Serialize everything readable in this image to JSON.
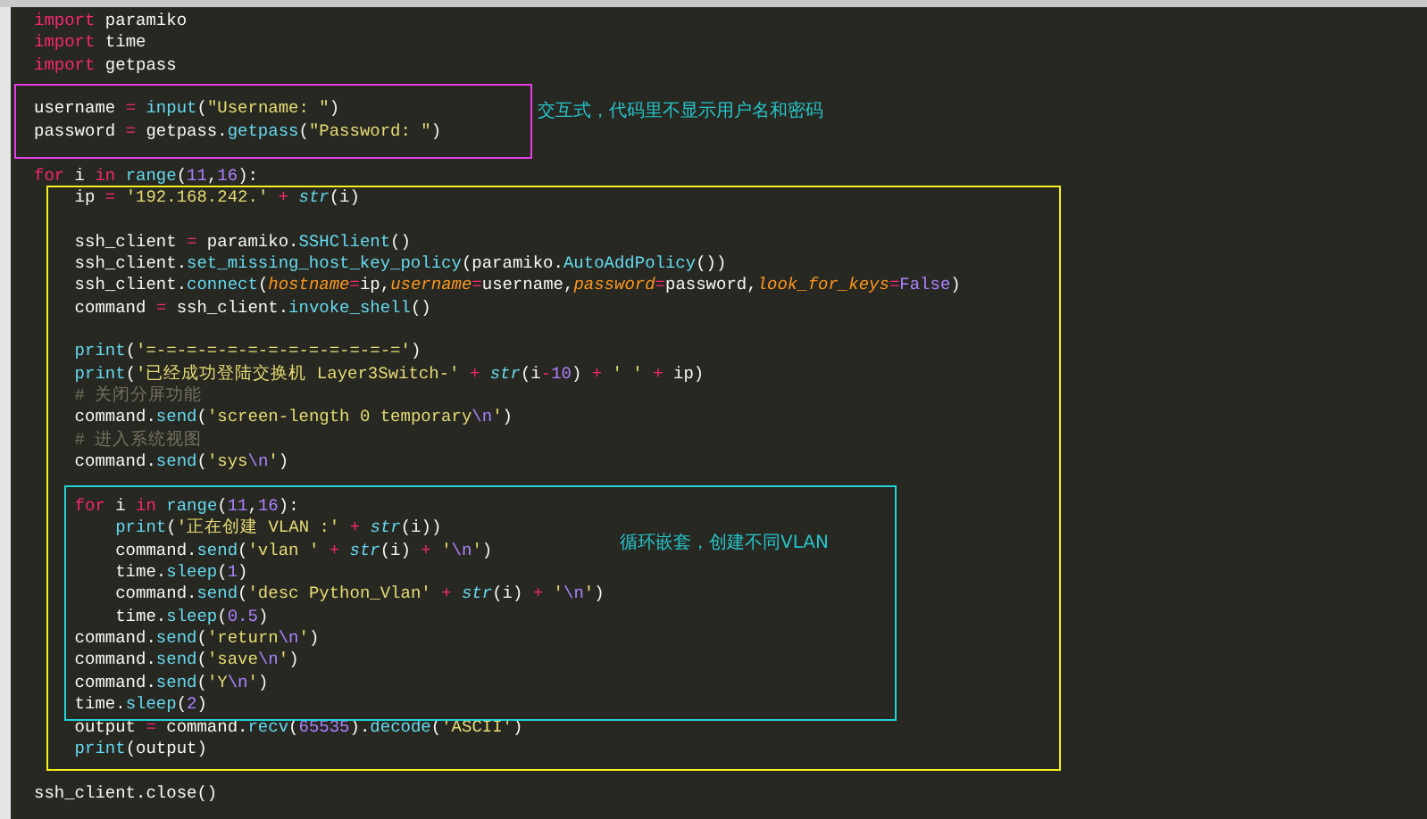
{
  "code_lines": [
    {
      "kind": "code",
      "tokens": [
        {
          "t": "import",
          "kind": "kw"
        },
        {
          "t": " paramiko",
          "kind": "text"
        }
      ]
    },
    {
      "kind": "code",
      "tokens": [
        {
          "t": "import",
          "kind": "kw"
        },
        {
          "t": " time",
          "kind": "text"
        }
      ]
    },
    {
      "kind": "code",
      "tokens": [
        {
          "t": "import",
          "kind": "kw"
        },
        {
          "t": " getpass",
          "kind": "text"
        }
      ]
    },
    {
      "kind": "blank"
    },
    {
      "kind": "code",
      "tokens": [
        {
          "t": "username ",
          "kind": "text"
        },
        {
          "t": "=",
          "kind": "op"
        },
        {
          "t": " input",
          "kind": "fn"
        },
        {
          "t": "(",
          "kind": "text"
        },
        {
          "t": "\"Username: \"",
          "kind": "str"
        },
        {
          "t": ")",
          "kind": "text"
        }
      ]
    },
    {
      "kind": "code",
      "tokens": [
        {
          "t": "password ",
          "kind": "text"
        },
        {
          "t": "=",
          "kind": "op"
        },
        {
          "t": " getpass.",
          "kind": "text"
        },
        {
          "t": "getpass",
          "kind": "fn"
        },
        {
          "t": "(",
          "kind": "text"
        },
        {
          "t": "\"Password: \"",
          "kind": "str"
        },
        {
          "t": ")",
          "kind": "text"
        }
      ]
    },
    {
      "kind": "blank"
    },
    {
      "kind": "code",
      "tokens": [
        {
          "t": "for",
          "kind": "kw"
        },
        {
          "t": " i ",
          "kind": "text"
        },
        {
          "t": "in",
          "kind": "kw"
        },
        {
          "t": " range",
          "kind": "fn"
        },
        {
          "t": "(",
          "kind": "text"
        },
        {
          "t": "11",
          "kind": "num"
        },
        {
          "t": ",",
          "kind": "text"
        },
        {
          "t": "16",
          "kind": "num"
        },
        {
          "t": "):",
          "kind": "text"
        }
      ]
    },
    {
      "kind": "code",
      "tokens": [
        {
          "t": "    ip ",
          "kind": "text"
        },
        {
          "t": "=",
          "kind": "op"
        },
        {
          "t": " '192.168.242.' ",
          "kind": "str"
        },
        {
          "t": "+",
          "kind": "op"
        },
        {
          "t": " str",
          "kind": "builtin"
        },
        {
          "t": "(i)",
          "kind": "text"
        }
      ]
    },
    {
      "kind": "blank"
    },
    {
      "kind": "code",
      "tokens": [
        {
          "t": "    ssh_client ",
          "kind": "text"
        },
        {
          "t": "=",
          "kind": "op"
        },
        {
          "t": " paramiko.",
          "kind": "text"
        },
        {
          "t": "SSHClient",
          "kind": "fn"
        },
        {
          "t": "()",
          "kind": "text"
        }
      ]
    },
    {
      "kind": "code",
      "tokens": [
        {
          "t": "    ssh_client.",
          "kind": "text"
        },
        {
          "t": "set_missing_host_key_policy",
          "kind": "fn"
        },
        {
          "t": "(paramiko.",
          "kind": "text"
        },
        {
          "t": "AutoAddPolicy",
          "kind": "fn"
        },
        {
          "t": "())",
          "kind": "text"
        }
      ]
    },
    {
      "kind": "code",
      "tokens": [
        {
          "t": "    ssh_client.",
          "kind": "text"
        },
        {
          "t": "connect",
          "kind": "fn"
        },
        {
          "t": "(",
          "kind": "text"
        },
        {
          "t": "hostname",
          "kind": "arg"
        },
        {
          "t": "=",
          "kind": "op"
        },
        {
          "t": "ip,",
          "kind": "text"
        },
        {
          "t": "username",
          "kind": "arg"
        },
        {
          "t": "=",
          "kind": "op"
        },
        {
          "t": "username,",
          "kind": "text"
        },
        {
          "t": "password",
          "kind": "arg"
        },
        {
          "t": "=",
          "kind": "op"
        },
        {
          "t": "password,",
          "kind": "text"
        },
        {
          "t": "look_for_keys",
          "kind": "arg"
        },
        {
          "t": "=",
          "kind": "op"
        },
        {
          "t": "False",
          "kind": "num"
        },
        {
          "t": ")",
          "kind": "text"
        }
      ]
    },
    {
      "kind": "code",
      "tokens": [
        {
          "t": "    command ",
          "kind": "text"
        },
        {
          "t": "=",
          "kind": "op"
        },
        {
          "t": " ssh_client.",
          "kind": "text"
        },
        {
          "t": "invoke_shell",
          "kind": "fn"
        },
        {
          "t": "()",
          "kind": "text"
        }
      ]
    },
    {
      "kind": "blank"
    },
    {
      "kind": "code",
      "tokens": [
        {
          "t": "    print",
          "kind": "fn"
        },
        {
          "t": "(",
          "kind": "text"
        },
        {
          "t": "'=-=-=-=-=-=-=-=-=-=-=-=-='",
          "kind": "str"
        },
        {
          "t": ")",
          "kind": "text"
        }
      ]
    },
    {
      "kind": "code",
      "tokens": [
        {
          "t": "    print",
          "kind": "fn"
        },
        {
          "t": "(",
          "kind": "text"
        },
        {
          "t": "'已经成功登陆交换机 Layer3Switch-' ",
          "kind": "str"
        },
        {
          "t": "+",
          "kind": "op"
        },
        {
          "t": " str",
          "kind": "builtin"
        },
        {
          "t": "(i",
          "kind": "text"
        },
        {
          "t": "-",
          "kind": "op"
        },
        {
          "t": "10",
          "kind": "num"
        },
        {
          "t": ") ",
          "kind": "text"
        },
        {
          "t": "+",
          "kind": "op"
        },
        {
          "t": " ' ' ",
          "kind": "str"
        },
        {
          "t": "+",
          "kind": "op"
        },
        {
          "t": " ip)",
          "kind": "text"
        }
      ]
    },
    {
      "kind": "code",
      "tokens": [
        {
          "t": "    # 关闭分屏功能",
          "kind": "comment"
        }
      ]
    },
    {
      "kind": "code",
      "tokens": [
        {
          "t": "    command.",
          "kind": "text"
        },
        {
          "t": "send",
          "kind": "fn"
        },
        {
          "t": "(",
          "kind": "text"
        },
        {
          "t": "'screen-length 0 temporary",
          "kind": "str"
        },
        {
          "t": "\\n",
          "kind": "num"
        },
        {
          "t": "'",
          "kind": "str"
        },
        {
          "t": ")",
          "kind": "text"
        }
      ]
    },
    {
      "kind": "code",
      "tokens": [
        {
          "t": "    # 进入系统视图",
          "kind": "comment"
        }
      ]
    },
    {
      "kind": "code",
      "tokens": [
        {
          "t": "    command.",
          "kind": "text"
        },
        {
          "t": "send",
          "kind": "fn"
        },
        {
          "t": "(",
          "kind": "text"
        },
        {
          "t": "'sys",
          "kind": "str"
        },
        {
          "t": "\\n",
          "kind": "num"
        },
        {
          "t": "'",
          "kind": "str"
        },
        {
          "t": ")",
          "kind": "text"
        }
      ]
    },
    {
      "kind": "blank"
    },
    {
      "kind": "code",
      "tokens": [
        {
          "t": "    for",
          "kind": "kw"
        },
        {
          "t": " i ",
          "kind": "text"
        },
        {
          "t": "in",
          "kind": "kw"
        },
        {
          "t": " range",
          "kind": "fn"
        },
        {
          "t": "(",
          "kind": "text"
        },
        {
          "t": "11",
          "kind": "num"
        },
        {
          "t": ",",
          "kind": "text"
        },
        {
          "t": "16",
          "kind": "num"
        },
        {
          "t": "):",
          "kind": "text"
        }
      ]
    },
    {
      "kind": "code",
      "tokens": [
        {
          "t": "        print",
          "kind": "fn"
        },
        {
          "t": "(",
          "kind": "text"
        },
        {
          "t": "'正在创建 VLAN :' ",
          "kind": "str"
        },
        {
          "t": "+",
          "kind": "op"
        },
        {
          "t": " str",
          "kind": "builtin"
        },
        {
          "t": "(i))",
          "kind": "text"
        }
      ]
    },
    {
      "kind": "code",
      "tokens": [
        {
          "t": "        command.",
          "kind": "text"
        },
        {
          "t": "send",
          "kind": "fn"
        },
        {
          "t": "(",
          "kind": "text"
        },
        {
          "t": "'vlan ' ",
          "kind": "str"
        },
        {
          "t": "+",
          "kind": "op"
        },
        {
          "t": " str",
          "kind": "builtin"
        },
        {
          "t": "(i) ",
          "kind": "text"
        },
        {
          "t": "+",
          "kind": "op"
        },
        {
          "t": " '",
          "kind": "str"
        },
        {
          "t": "\\n",
          "kind": "num"
        },
        {
          "t": "'",
          "kind": "str"
        },
        {
          "t": ")",
          "kind": "text"
        }
      ]
    },
    {
      "kind": "code",
      "tokens": [
        {
          "t": "        time.",
          "kind": "text"
        },
        {
          "t": "sleep",
          "kind": "fn"
        },
        {
          "t": "(",
          "kind": "text"
        },
        {
          "t": "1",
          "kind": "num"
        },
        {
          "t": ")",
          "kind": "text"
        }
      ]
    },
    {
      "kind": "code",
      "tokens": [
        {
          "t": "        command.",
          "kind": "text"
        },
        {
          "t": "send",
          "kind": "fn"
        },
        {
          "t": "(",
          "kind": "text"
        },
        {
          "t": "'desc Python_Vlan' ",
          "kind": "str"
        },
        {
          "t": "+",
          "kind": "op"
        },
        {
          "t": " str",
          "kind": "builtin"
        },
        {
          "t": "(i) ",
          "kind": "text"
        },
        {
          "t": "+",
          "kind": "op"
        },
        {
          "t": " '",
          "kind": "str"
        },
        {
          "t": "\\n",
          "kind": "num"
        },
        {
          "t": "'",
          "kind": "str"
        },
        {
          "t": ")",
          "kind": "text"
        }
      ]
    },
    {
      "kind": "code",
      "tokens": [
        {
          "t": "        time.",
          "kind": "text"
        },
        {
          "t": "sleep",
          "kind": "fn"
        },
        {
          "t": "(",
          "kind": "text"
        },
        {
          "t": "0.5",
          "kind": "num"
        },
        {
          "t": ")",
          "kind": "text"
        }
      ]
    },
    {
      "kind": "code",
      "tokens": [
        {
          "t": "    command.",
          "kind": "text"
        },
        {
          "t": "send",
          "kind": "fn"
        },
        {
          "t": "(",
          "kind": "text"
        },
        {
          "t": "'return",
          "kind": "str"
        },
        {
          "t": "\\n",
          "kind": "num"
        },
        {
          "t": "'",
          "kind": "str"
        },
        {
          "t": ")",
          "kind": "text"
        }
      ]
    },
    {
      "kind": "code",
      "tokens": [
        {
          "t": "    command.",
          "kind": "text"
        },
        {
          "t": "send",
          "kind": "fn"
        },
        {
          "t": "(",
          "kind": "text"
        },
        {
          "t": "'save",
          "kind": "str"
        },
        {
          "t": "\\n",
          "kind": "num"
        },
        {
          "t": "'",
          "kind": "str"
        },
        {
          "t": ")",
          "kind": "text"
        }
      ]
    },
    {
      "kind": "code",
      "tokens": [
        {
          "t": "    command.",
          "kind": "text"
        },
        {
          "t": "send",
          "kind": "fn"
        },
        {
          "t": "(",
          "kind": "text"
        },
        {
          "t": "'Y",
          "kind": "str"
        },
        {
          "t": "\\n",
          "kind": "num"
        },
        {
          "t": "'",
          "kind": "str"
        },
        {
          "t": ")",
          "kind": "text"
        }
      ]
    },
    {
      "kind": "code",
      "tokens": [
        {
          "t": "    time.",
          "kind": "text"
        },
        {
          "t": "sleep",
          "kind": "fn"
        },
        {
          "t": "(",
          "kind": "text"
        },
        {
          "t": "2",
          "kind": "num"
        },
        {
          "t": ")",
          "kind": "text"
        }
      ]
    },
    {
      "kind": "code",
      "tokens": [
        {
          "t": "    output ",
          "kind": "text"
        },
        {
          "t": "=",
          "kind": "op"
        },
        {
          "t": " command.",
          "kind": "text"
        },
        {
          "t": "recv",
          "kind": "fn"
        },
        {
          "t": "(",
          "kind": "text"
        },
        {
          "t": "65535",
          "kind": "num"
        },
        {
          "t": ").",
          "kind": "text"
        },
        {
          "t": "decode",
          "kind": "fn"
        },
        {
          "t": "(",
          "kind": "text"
        },
        {
          "t": "'ASCII'",
          "kind": "str"
        },
        {
          "t": ")",
          "kind": "text"
        }
      ]
    },
    {
      "kind": "code",
      "tokens": [
        {
          "t": "    print",
          "kind": "fn"
        },
        {
          "t": "(output)",
          "kind": "text"
        }
      ]
    },
    {
      "kind": "blank"
    },
    {
      "kind": "code",
      "tokens": [
        {
          "t": "ssh_client.close()",
          "kind": "text"
        }
      ]
    }
  ],
  "highlights": [
    {
      "color": "#e83ee8",
      "note": "交互式，代码里不显示用户名和密码"
    },
    {
      "color": "#f5f01e"
    },
    {
      "color": "#22d3d8",
      "note": "循环嵌套，创建不同VLAN"
    }
  ]
}
